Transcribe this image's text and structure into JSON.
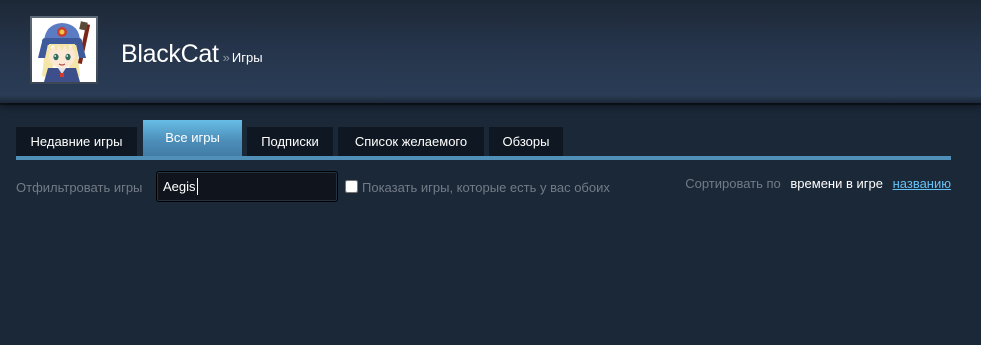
{
  "profile": {
    "name": "BlackCat",
    "breadcrumb_separator": "»",
    "section": "Игры",
    "avatar_icon": "anime-girl-avatar"
  },
  "tabs": [
    {
      "label": "Недавние игры",
      "active": false
    },
    {
      "label": "Все игры",
      "active": true
    },
    {
      "label": "Подписки",
      "active": false
    },
    {
      "label": "Список желаемого",
      "active": false
    },
    {
      "label": "Обзоры",
      "active": false
    }
  ],
  "filter": {
    "label": "Отфильтровать игры",
    "value": "Aegis",
    "placeholder": ""
  },
  "own_checkbox": {
    "label": "Показать игры, которые есть у вас обоих",
    "checked": false
  },
  "sort": {
    "label": "Сортировать по",
    "active_option": "времени в игре",
    "link_option": "названию"
  },
  "colors": {
    "background": "#1b2838",
    "active_tab": "#67bde6",
    "tab_underline": "#4f8fb8",
    "link": "#67c1f5",
    "muted_text": "#727b86"
  }
}
